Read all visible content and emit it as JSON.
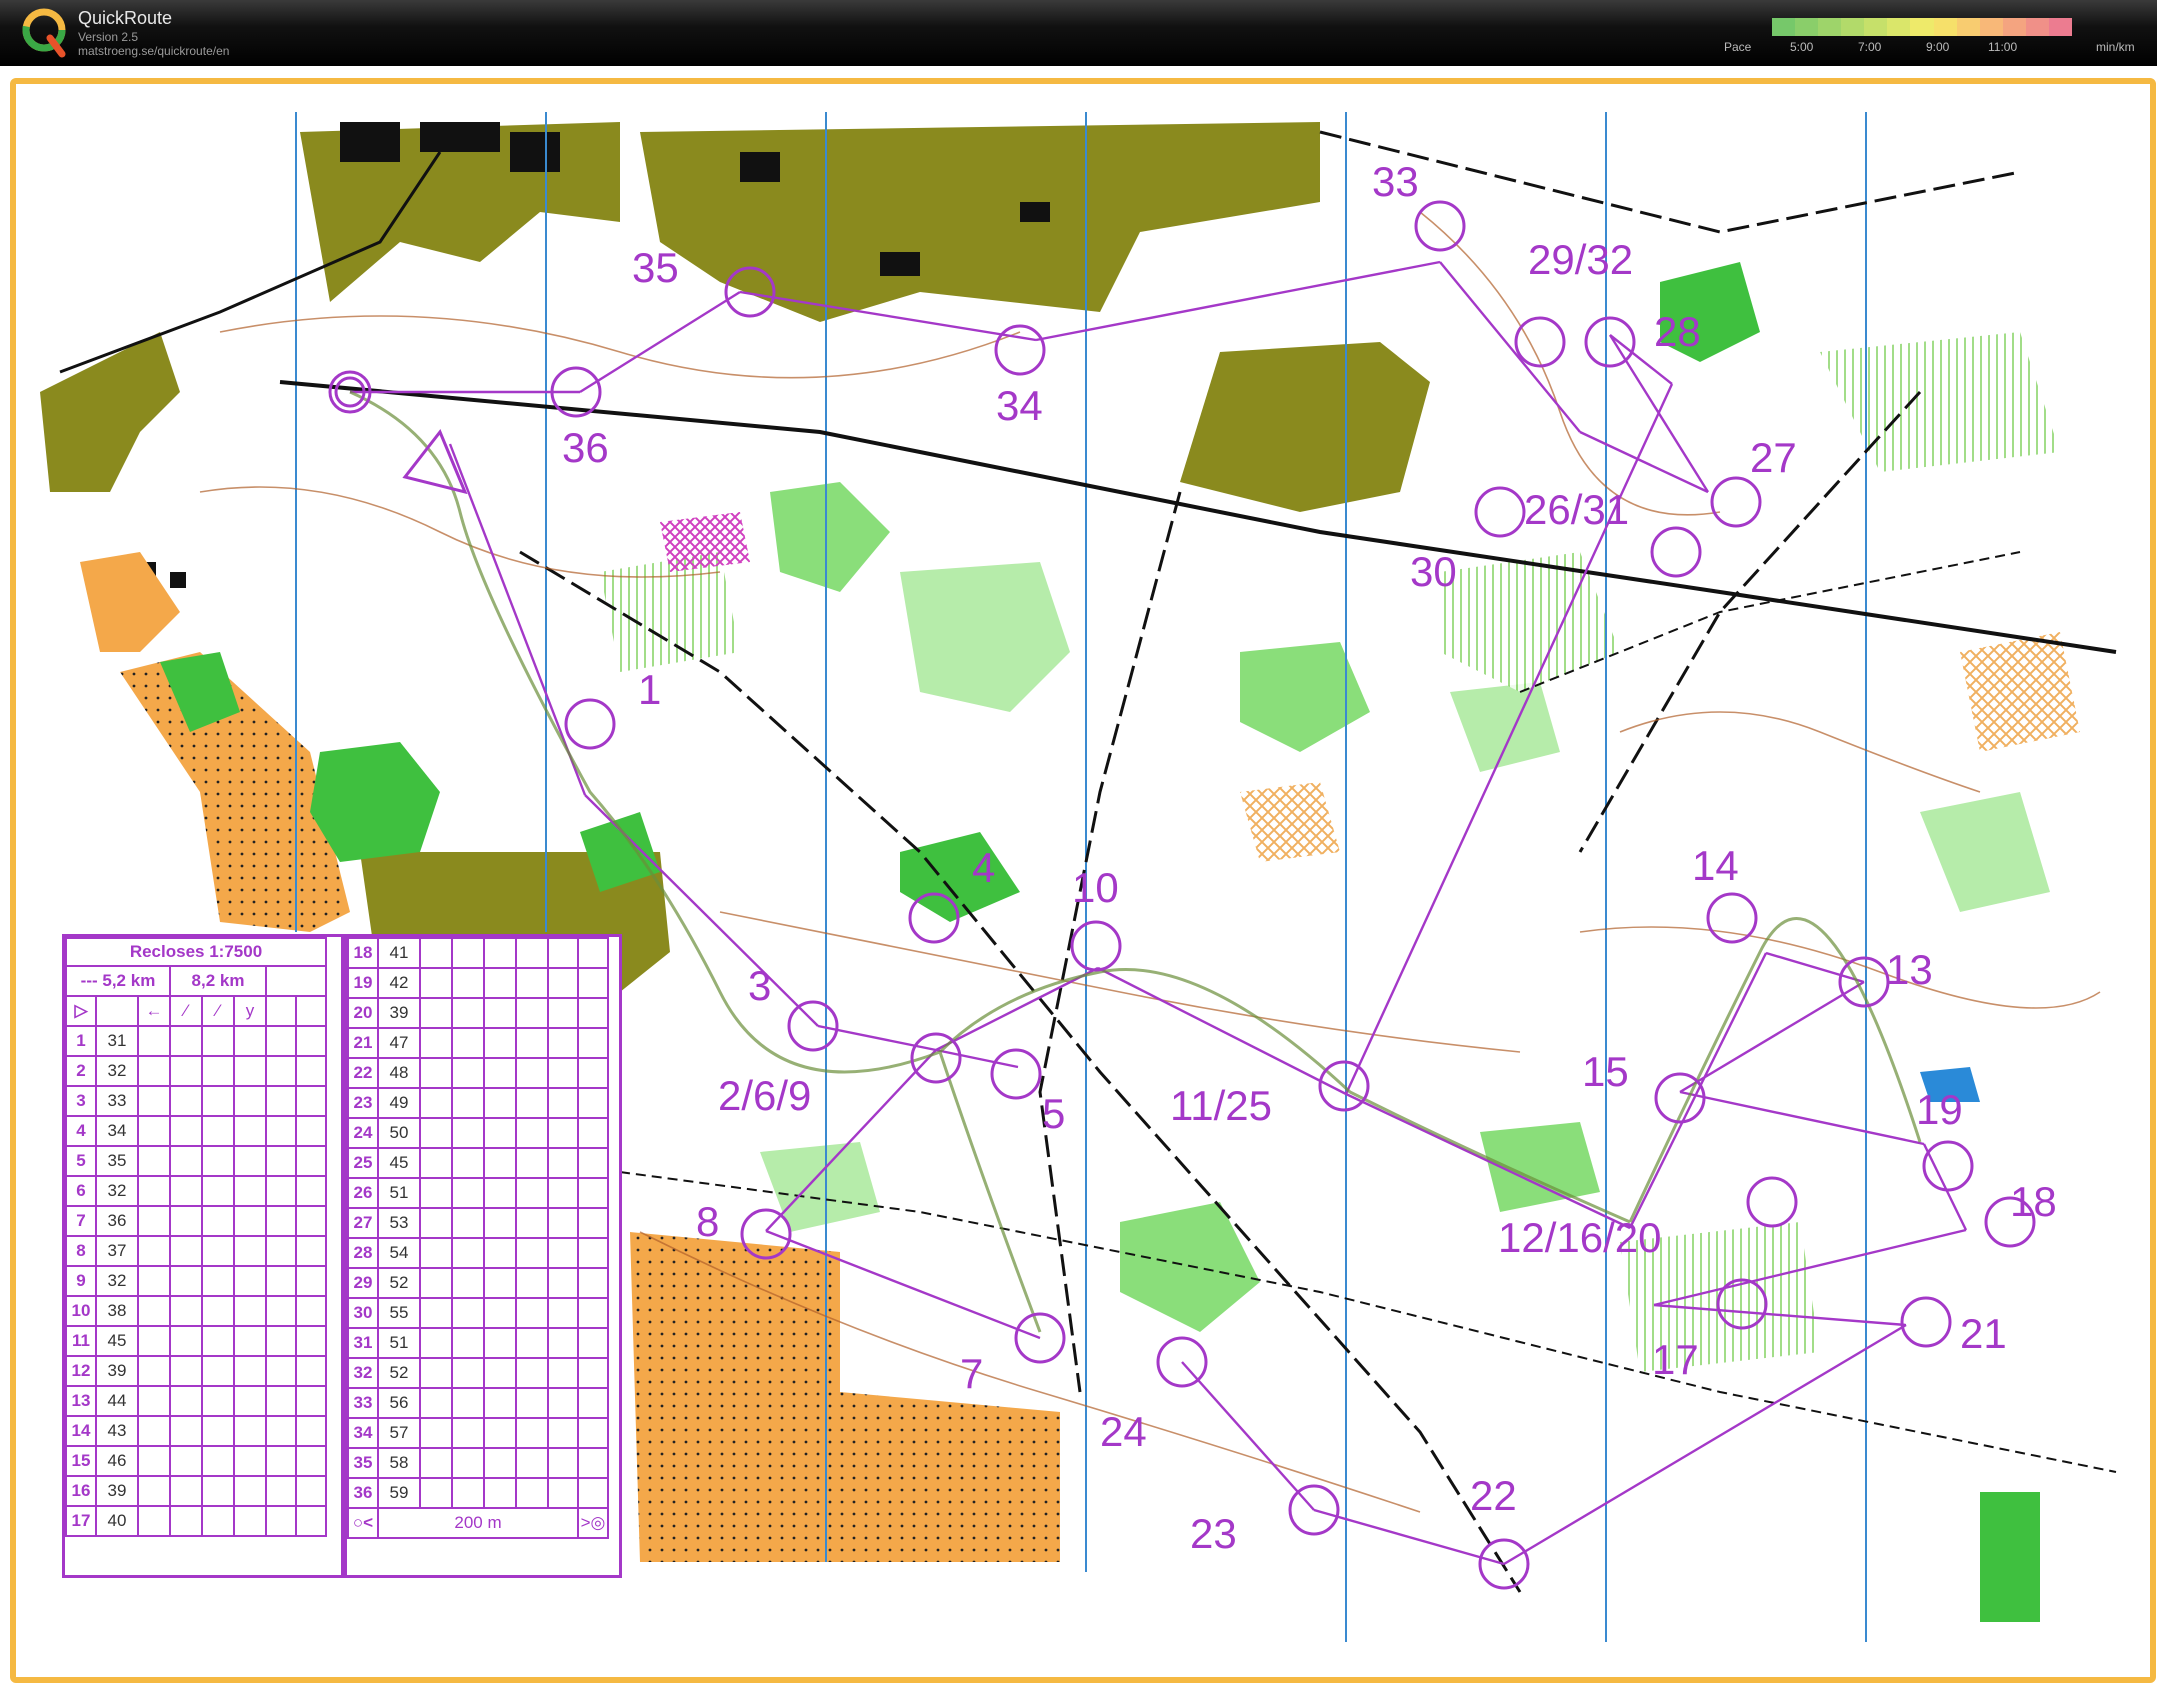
{
  "app": {
    "title": "QuickRoute",
    "version": "Version 2.5",
    "url": "matstroeng.se/quickroute/en"
  },
  "pace_scale": {
    "label": "Pace",
    "ticks": [
      "5:00",
      "7:00",
      "9:00",
      "11:00"
    ],
    "unit": "min/km",
    "colors": [
      "#76c86a",
      "#8ace6a",
      "#9ed46a",
      "#b2da6a",
      "#c6e06a",
      "#daE66a",
      "#eeea6a",
      "#f6e06a",
      "#f8cc70",
      "#f8b878",
      "#f4a480",
      "#f09088",
      "#ec7c90"
    ]
  },
  "colors": {
    "frame": "#f5b942",
    "course": "#a438c8",
    "route": "#8b4513"
  },
  "map": {
    "control_labels": [
      "1",
      "3",
      "4",
      "10",
      "2/6/9",
      "5",
      "11/25",
      "8",
      "7",
      "24",
      "23",
      "22",
      "33",
      "35",
      "36",
      "34",
      "29/32",
      "28",
      "27",
      "26/31",
      "30",
      "14",
      "13",
      "15",
      "19",
      "18",
      "12/16/20",
      "17",
      "21"
    ]
  },
  "legend": {
    "title": "Recloses 1:7500",
    "length_1": "--- 5,2 km",
    "length_2": "8,2 km",
    "scale_text": "200 m",
    "rows_left": [
      {
        "n": "1",
        "c": "31"
      },
      {
        "n": "2",
        "c": "32"
      },
      {
        "n": "3",
        "c": "33"
      },
      {
        "n": "4",
        "c": "34"
      },
      {
        "n": "5",
        "c": "35"
      },
      {
        "n": "6",
        "c": "32"
      },
      {
        "n": "7",
        "c": "36"
      },
      {
        "n": "8",
        "c": "37"
      },
      {
        "n": "9",
        "c": "32"
      },
      {
        "n": "10",
        "c": "38"
      },
      {
        "n": "11",
        "c": "45"
      },
      {
        "n": "12",
        "c": "39"
      },
      {
        "n": "13",
        "c": "44"
      },
      {
        "n": "14",
        "c": "43"
      },
      {
        "n": "15",
        "c": "46"
      },
      {
        "n": "16",
        "c": "39"
      },
      {
        "n": "17",
        "c": "40"
      }
    ],
    "rows_right": [
      {
        "n": "18",
        "c": "41"
      },
      {
        "n": "19",
        "c": "42"
      },
      {
        "n": "20",
        "c": "39"
      },
      {
        "n": "21",
        "c": "47"
      },
      {
        "n": "22",
        "c": "48"
      },
      {
        "n": "23",
        "c": "49"
      },
      {
        "n": "24",
        "c": "50"
      },
      {
        "n": "25",
        "c": "45"
      },
      {
        "n": "26",
        "c": "51"
      },
      {
        "n": "27",
        "c": "53"
      },
      {
        "n": "28",
        "c": "54"
      },
      {
        "n": "29",
        "c": "52"
      },
      {
        "n": "30",
        "c": "55"
      },
      {
        "n": "31",
        "c": "51"
      },
      {
        "n": "32",
        "c": "52"
      },
      {
        "n": "33",
        "c": "56"
      },
      {
        "n": "34",
        "c": "57"
      },
      {
        "n": "35",
        "c": "58"
      },
      {
        "n": "36",
        "c": "59"
      }
    ]
  }
}
